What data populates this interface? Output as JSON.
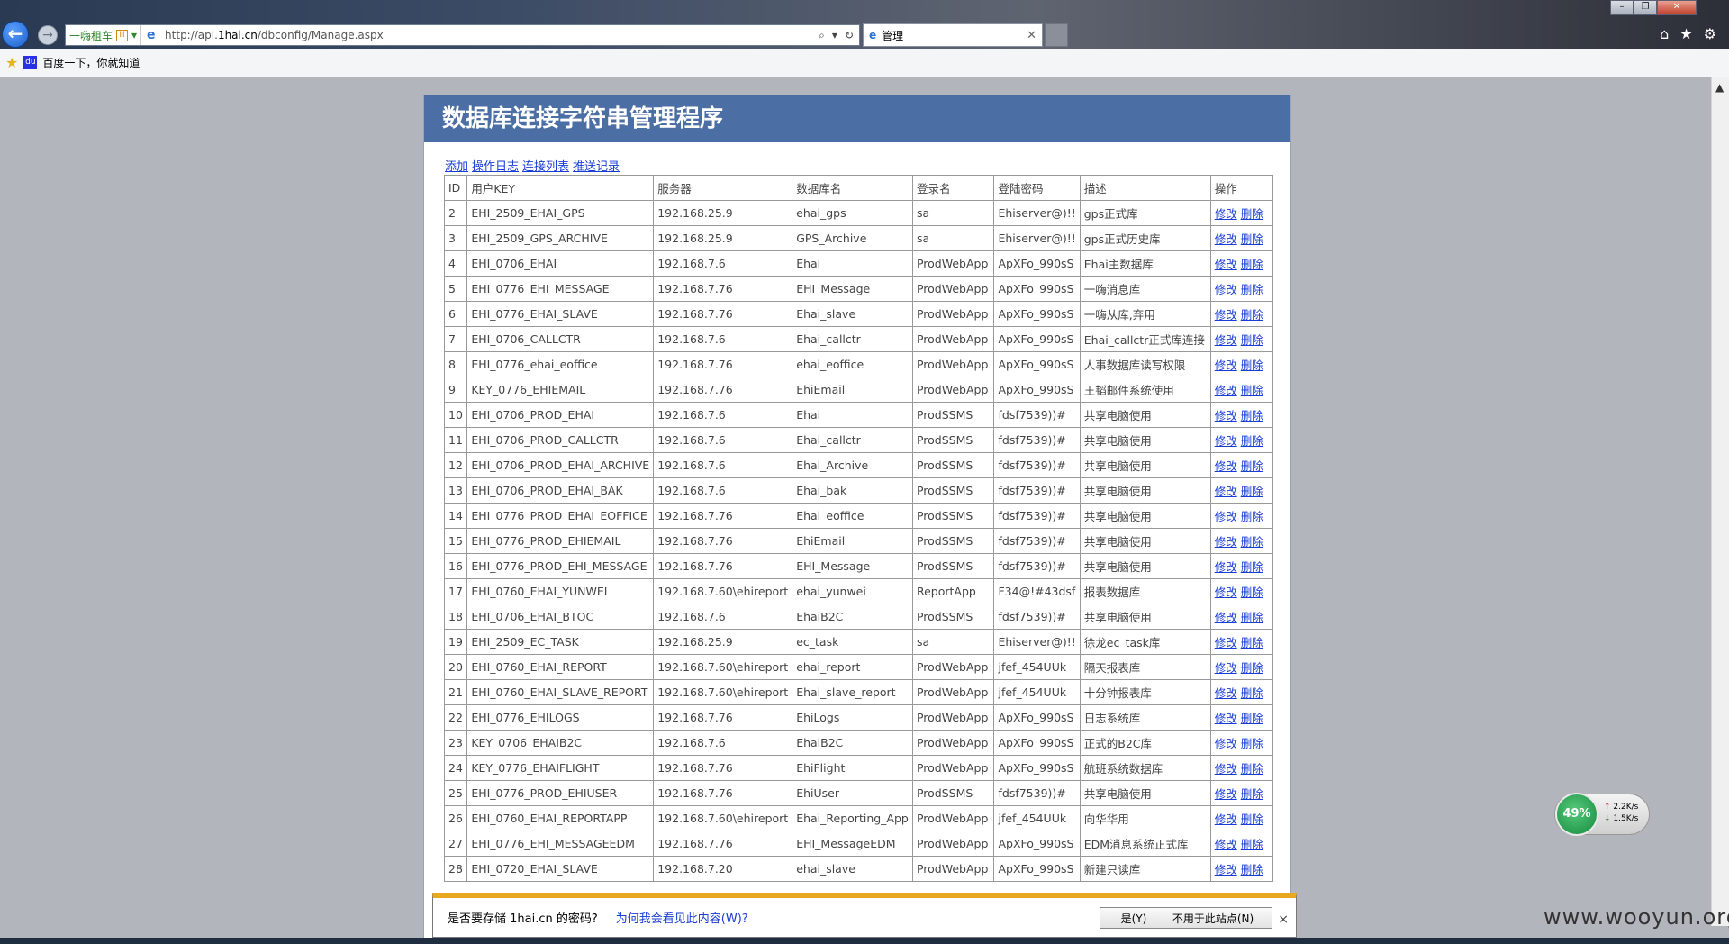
{
  "browser": {
    "quick_link": "一嗨租车",
    "compat_badge": "Ⅲ",
    "url_prefix": "http://api.",
    "url_domain": "1hai.cn",
    "url_path": "/dbconfig/Manage.aspx",
    "tab_title": "管理",
    "favorites_item": "百度一下，你就知道"
  },
  "page": {
    "title": "数据库连接字符串管理程序",
    "links": [
      "添加",
      "操作日志",
      "连接列表",
      "推送记录"
    ]
  },
  "table": {
    "headers": [
      "ID",
      "用户KEY",
      "服务器",
      "数据库名",
      "登录名",
      "登陆密码",
      "描述",
      "操作"
    ],
    "action_edit": "修改",
    "action_delete": "删除",
    "rows": [
      [
        "2",
        "EHI_2509_EHAI_GPS",
        "192.168.25.9",
        "ehai_gps",
        "sa",
        "Ehiserver@)!!",
        "gps正式库"
      ],
      [
        "3",
        "EHI_2509_GPS_ARCHIVE",
        "192.168.25.9",
        "GPS_Archive",
        "sa",
        "Ehiserver@)!!",
        "gps正式历史库"
      ],
      [
        "4",
        "EHI_0706_EHAI",
        "192.168.7.6",
        "Ehai",
        "ProdWebApp",
        "ApXFo_990sS",
        "Ehai主数据库"
      ],
      [
        "5",
        "EHI_0776_EHI_MESSAGE",
        "192.168.7.76",
        "EHI_Message",
        "ProdWebApp",
        "ApXFo_990sS",
        "一嗨消息库"
      ],
      [
        "6",
        "EHI_0776_EHAI_SLAVE",
        "192.168.7.76",
        "Ehai_slave",
        "ProdWebApp",
        "ApXFo_990sS",
        "一嗨从库,弃用"
      ],
      [
        "7",
        "EHI_0706_CALLCTR",
        "192.168.7.6",
        "Ehai_callctr",
        "ProdWebApp",
        "ApXFo_990sS",
        "Ehai_callctr正式库连接"
      ],
      [
        "8",
        "EHI_0776_ehai_eoffice",
        "192.168.7.76",
        "ehai_eoffice",
        "ProdWebApp",
        "ApXFo_990sS",
        "人事数据库读写权限"
      ],
      [
        "9",
        "KEY_0776_EHIEMAIL",
        "192.168.7.76",
        "EhiEmail",
        "ProdWebApp",
        "ApXFo_990sS",
        "王韬邮件系统使用"
      ],
      [
        "10",
        "EHI_0706_PROD_EHAI",
        "192.168.7.6",
        "Ehai",
        "ProdSSMS",
        "fdsf7539))#",
        "共享电脑使用"
      ],
      [
        "11",
        "EHI_0706_PROD_CALLCTR",
        "192.168.7.6",
        "Ehai_callctr",
        "ProdSSMS",
        "fdsf7539))#",
        "共享电脑使用"
      ],
      [
        "12",
        "EHI_0706_PROD_EHAI_ARCHIVE",
        "192.168.7.6",
        "Ehai_Archive",
        "ProdSSMS",
        "fdsf7539))#",
        "共享电脑使用"
      ],
      [
        "13",
        "EHI_0706_PROD_EHAI_BAK",
        "192.168.7.6",
        "Ehai_bak",
        "ProdSSMS",
        "fdsf7539))#",
        "共享电脑使用"
      ],
      [
        "14",
        "EHI_0776_PROD_EHAI_EOFFICE",
        "192.168.7.76",
        "Ehai_eoffice",
        "ProdSSMS",
        "fdsf7539))#",
        "共享电脑使用"
      ],
      [
        "15",
        "EHI_0776_PROD_EHIEMAIL",
        "192.168.7.76",
        "EhiEmail",
        "ProdSSMS",
        "fdsf7539))#",
        "共享电脑使用"
      ],
      [
        "16",
        "EHI_0776_PROD_EHI_MESSAGE",
        "192.168.7.76",
        "EHI_Message",
        "ProdSSMS",
        "fdsf7539))#",
        "共享电脑使用"
      ],
      [
        "17",
        "EHI_0760_EHAI_YUNWEI",
        "192.168.7.60\\ehireport",
        "ehai_yunwei",
        "ReportApp",
        "F34@!#43dsf",
        "报表数据库"
      ],
      [
        "18",
        "EHI_0706_EHAI_BTOC",
        "192.168.7.6",
        "EhaiB2C",
        "ProdSSMS",
        "fdsf7539))#",
        "共享电脑使用"
      ],
      [
        "19",
        "EHI_2509_EC_TASK",
        "192.168.25.9",
        "ec_task",
        "sa",
        "Ehiserver@)!!",
        "徐龙ec_task库"
      ],
      [
        "20",
        "EHI_0760_EHAI_REPORT",
        "192.168.7.60\\ehireport",
        "ehai_report",
        "ProdWebApp",
        "jfef_454UUk",
        "隔天报表库"
      ],
      [
        "21",
        "EHI_0760_EHAI_SLAVE_REPORT",
        "192.168.7.60\\ehireport",
        "Ehai_slave_report",
        "ProdWebApp",
        "jfef_454UUk",
        "十分钟报表库"
      ],
      [
        "22",
        "EHI_0776_EHILOGS",
        "192.168.7.76",
        "EhiLogs",
        "ProdWebApp",
        "ApXFo_990sS",
        "日志系统库"
      ],
      [
        "23",
        "KEY_0706_EHAIB2C",
        "192.168.7.6",
        "EhaiB2C",
        "ProdWebApp",
        "ApXFo_990sS",
        "正式的B2C库"
      ],
      [
        "24",
        "KEY_0776_EHAIFLIGHT",
        "192.168.7.76",
        "EhiFlight",
        "ProdWebApp",
        "ApXFo_990sS",
        "航班系统数据库"
      ],
      [
        "25",
        "EHI_0776_PROD_EHIUSER",
        "192.168.7.76",
        "EhiUser",
        "ProdSSMS",
        "fdsf7539))#",
        "共享电脑使用"
      ],
      [
        "26",
        "EHI_0760_EHAI_REPORTAPP",
        "192.168.7.60\\ehireport",
        "Ehai_Reporting_App",
        "ProdWebApp",
        "jfef_454UUk",
        "向华华用"
      ],
      [
        "27",
        "EHI_0776_EHI_MESSAGEEDM",
        "192.168.7.76",
        "EHI_MessageEDM",
        "ProdWebApp",
        "ApXFo_990sS",
        "EDM消息系统正式库"
      ],
      [
        "28",
        "EHI_0720_EHAI_SLAVE",
        "192.168.7.20",
        "ehai_slave",
        "ProdWebApp",
        "ApXFo_990sS",
        "新建只读库"
      ]
    ]
  },
  "prompt": {
    "message": "是否要存储 1hai.cn 的密码?",
    "why_link": "为何我会看见此内容(W)?",
    "yes_button": "是(Y)",
    "no_button": "不用于此站点(N)",
    "close": "×"
  },
  "network_widget": {
    "percent": "49%",
    "up_rate": "2.2K/s",
    "down_rate": "1.5K/s"
  },
  "watermark": "www.wooyun.org"
}
